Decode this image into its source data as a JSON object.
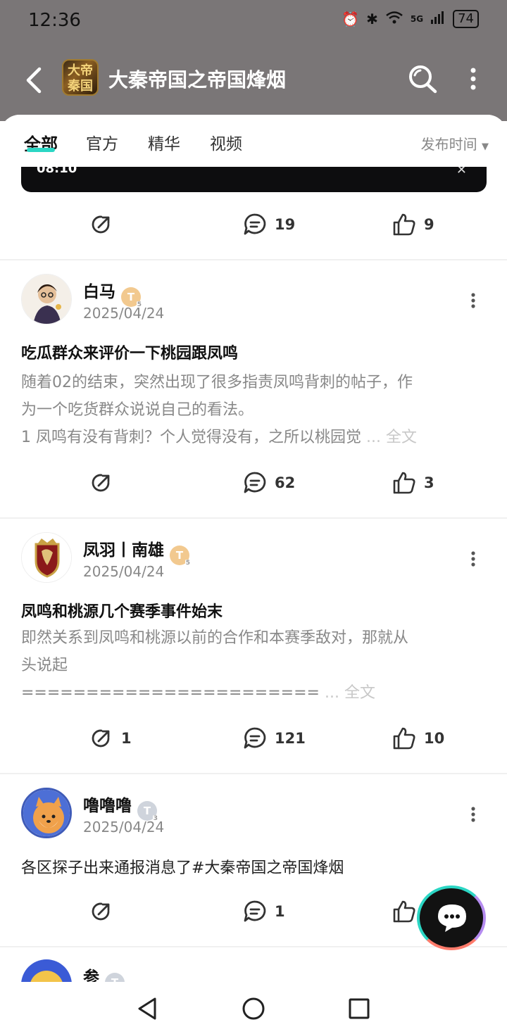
{
  "status": {
    "time": "12:36",
    "net": "5G",
    "battery": "74"
  },
  "header": {
    "title": "大秦帝国之帝国烽烟",
    "logo_text": "大秦帝国"
  },
  "tabs": [
    {
      "label": "全部"
    },
    {
      "label": "官方"
    },
    {
      "label": "精华"
    },
    {
      "label": "视频"
    }
  ],
  "sort_label": "发布时间",
  "video": {
    "time": "08:10"
  },
  "top_actions": {
    "share": "",
    "comments": "19",
    "likes": "9"
  },
  "posts": [
    {
      "user": "白马",
      "date": "2025/04/24",
      "title": "吃瓜群众来评价一下桃园跟凤鸣",
      "body_lines": [
        "随着02的结束，突然出现了很多指责凤鸣背刺的帖子，作",
        "为一个吃货群众说说自己的看法。",
        "1 凤鸣有没有背刺？个人觉得没有，之所以桃园觉"
      ],
      "share": "",
      "comments": "62",
      "likes": "3"
    },
    {
      "user": "凤羽丨南雄",
      "date": "2025/04/24",
      "title": "凤鸣和桃源几个赛季事件始末",
      "body_lines": [
        "即然关系到凤鸣和桃源以前的合作和本赛季敌对，那就从",
        "头说起",
        "======================="
      ],
      "share": "1",
      "comments": "121",
      "likes": "10"
    },
    {
      "user": "噜噜噜",
      "date": "2025/04/24",
      "text": "各区探子出来通报消息了#大秦帝国之帝国烽烟",
      "share": "",
      "comments": "1",
      "likes": ""
    },
    {
      "user": "参"
    }
  ],
  "more_suffix": "... 全文",
  "badge_letter": "T",
  "badge_levels": {
    "gold": "5",
    "silver": "3"
  },
  "colors": {
    "accent": "#2bd6c4",
    "header_bg": "#7a7677"
  }
}
